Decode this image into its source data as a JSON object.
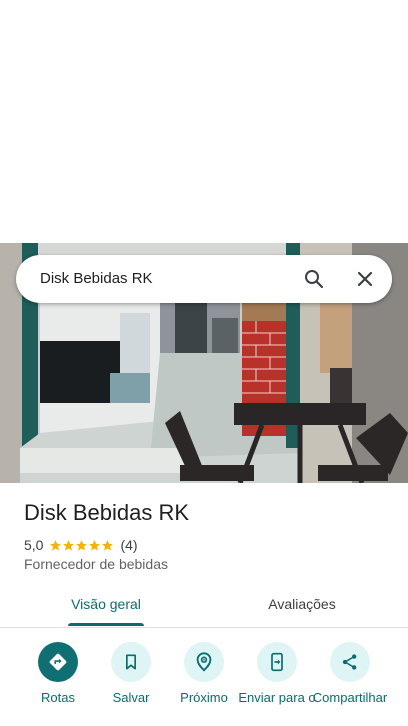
{
  "search": {
    "query": "Disk Bebidas RK"
  },
  "place": {
    "name": "Disk Bebidas RK",
    "rating": "5,0",
    "stars": 5,
    "review_count": "(4)",
    "category": "Fornecedor de bebidas"
  },
  "tabs": [
    {
      "label": "Visão geral",
      "active": true
    },
    {
      "label": "Avaliações",
      "active": false
    }
  ],
  "actions": [
    {
      "label": "Rotas",
      "icon": "directions-icon"
    },
    {
      "label": "Salvar",
      "icon": "bookmark-icon"
    },
    {
      "label": "Próximo",
      "icon": "nearby-icon"
    },
    {
      "label": "Enviar para o",
      "icon": "send-to-phone-icon"
    },
    {
      "label": "Compartilhar",
      "icon": "share-icon"
    }
  ],
  "colors": {
    "accent": "#0b6b6e",
    "action_bg": "#dff4f4",
    "primary_action": "#0f6f73",
    "star": "#f6b400"
  }
}
